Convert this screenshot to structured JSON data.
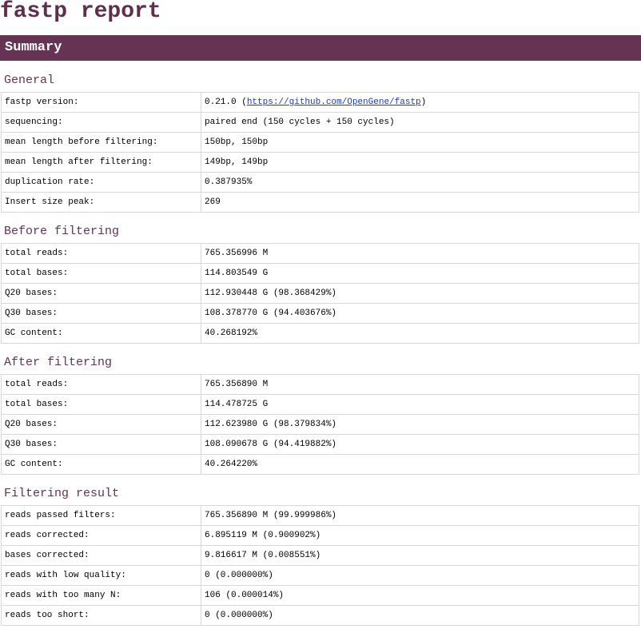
{
  "title": "fastp report",
  "summary_label": "Summary",
  "sections": {
    "general": {
      "heading": "General",
      "rows": [
        {
          "key": "fastp version:",
          "value_pre": "0.21.0 (",
          "link": "https://github.com/OpenGene/fastp",
          "value_post": ")"
        },
        {
          "key": "sequencing:",
          "value": "paired end (150 cycles + 150 cycles)"
        },
        {
          "key": "mean length before filtering:",
          "value": "150bp, 150bp"
        },
        {
          "key": "mean length after filtering:",
          "value": "149bp, 149bp"
        },
        {
          "key": "duplication rate:",
          "value": "0.387935%"
        },
        {
          "key": "Insert size peak:",
          "value": "269"
        }
      ]
    },
    "before": {
      "heading": "Before filtering",
      "rows": [
        {
          "key": "total reads:",
          "value": "765.356996 M"
        },
        {
          "key": "total bases:",
          "value": "114.803549 G"
        },
        {
          "key": "Q20 bases:",
          "value": "112.930448 G (98.368429%)"
        },
        {
          "key": "Q30 bases:",
          "value": "108.378770 G (94.403676%)"
        },
        {
          "key": "GC content:",
          "value": "40.268192%"
        }
      ]
    },
    "after": {
      "heading": "After filtering",
      "rows": [
        {
          "key": "total reads:",
          "value": "765.356890 M"
        },
        {
          "key": "total bases:",
          "value": "114.478725 G"
        },
        {
          "key": "Q20 bases:",
          "value": "112.623980 G (98.379834%)"
        },
        {
          "key": "Q30 bases:",
          "value": "108.090678 G (94.419882%)"
        },
        {
          "key": "GC content:",
          "value": "40.264220%"
        }
      ]
    },
    "filtering": {
      "heading": "Filtering result",
      "rows": [
        {
          "key": "reads passed filters:",
          "value": "765.356890 M (99.999986%)"
        },
        {
          "key": "reads corrected:",
          "value": "6.895119 M (0.900902%)"
        },
        {
          "key": "bases corrected:",
          "value": "9.816617 M (0.008551%)"
        },
        {
          "key": "reads with low quality:",
          "value": "0 (0.000000%)"
        },
        {
          "key": "reads with too many N:",
          "value": "106 (0.000014%)"
        },
        {
          "key": "reads too short:",
          "value": "0 (0.000000%)"
        }
      ]
    }
  },
  "colors": {
    "title": "#5f2e4e",
    "summary_bar": "#663355",
    "section_heading": "#663355",
    "link": "#1a3cc9",
    "cell_border": "#d8d8d8"
  }
}
